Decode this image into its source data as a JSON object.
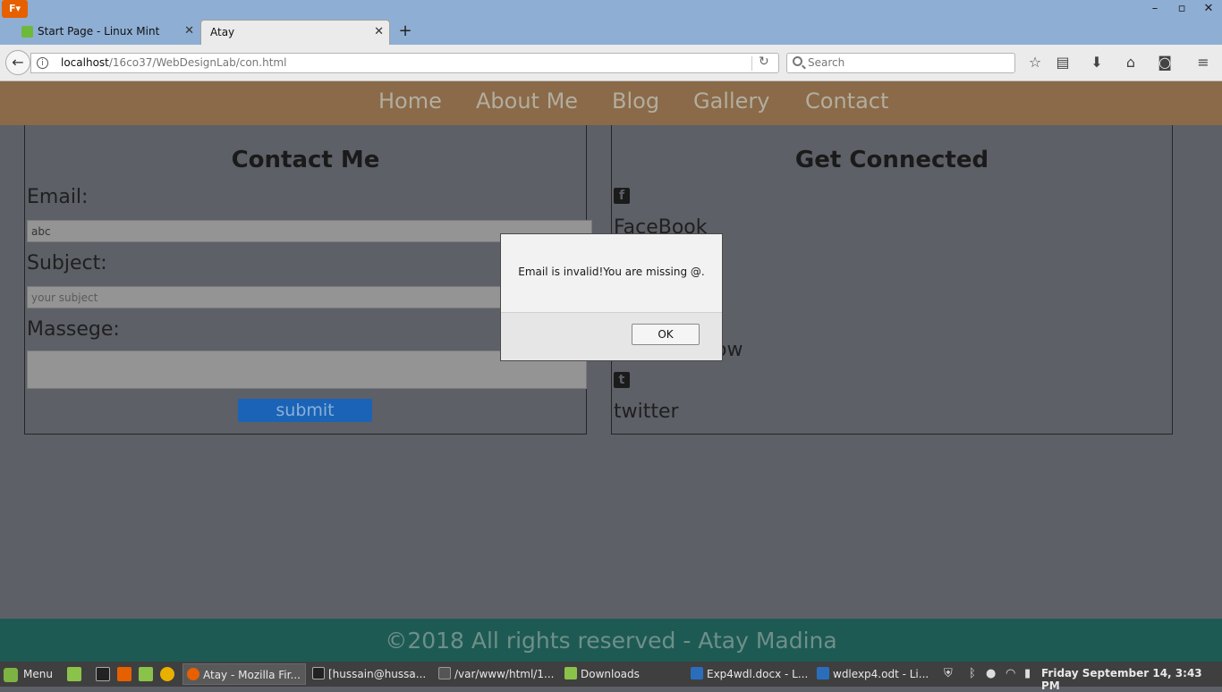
{
  "browser": {
    "menu_button": "F",
    "window_controls": {
      "minimize": "–",
      "maximize": "▫",
      "close": "✕"
    },
    "tabs": [
      {
        "title": "Start Page - Linux Mint",
        "active": false
      },
      {
        "title": "Atay",
        "active": true
      }
    ],
    "new_tab": "+",
    "url_host": "localhost",
    "url_path": "/16co37/WebDesignLab/con.html",
    "search_placeholder": "Search"
  },
  "site": {
    "nav": [
      "Home",
      "About Me",
      "Blog",
      "Gallery",
      "Contact"
    ],
    "contact": {
      "title": "Contact Me",
      "email_label": "Email:",
      "email_value": "abc",
      "subject_label": "Subject:",
      "subject_placeholder": "your subject",
      "message_label": "Massege:",
      "submit": "submit"
    },
    "connected": {
      "title": "Get Connected",
      "links": [
        {
          "icon": "facebook-icon",
          "label": "FaceBook"
        },
        {
          "icon": "stackoverflow-icon",
          "label": "ow"
        },
        {
          "icon": "twitter-icon",
          "label": "twitter"
        }
      ]
    },
    "footer": "©2018 All rights reserved - Atay Madina"
  },
  "dialog": {
    "message": "Email is invalid!You are missing @.",
    "ok": "OK"
  },
  "taskbar": {
    "menu": "Menu",
    "tasks": [
      {
        "label": "Atay - Mozilla Fir...",
        "active": true
      },
      {
        "label": "[hussain@hussa...",
        "active": false
      },
      {
        "label": "/var/www/html/1...",
        "active": false
      },
      {
        "label": "Downloads",
        "active": false
      },
      {
        "label": "Exp4wdl.docx - L...",
        "active": false
      },
      {
        "label": "wdlexp4.odt - Li...",
        "active": false
      }
    ],
    "clock": "Friday September 14,  3:43 PM"
  }
}
